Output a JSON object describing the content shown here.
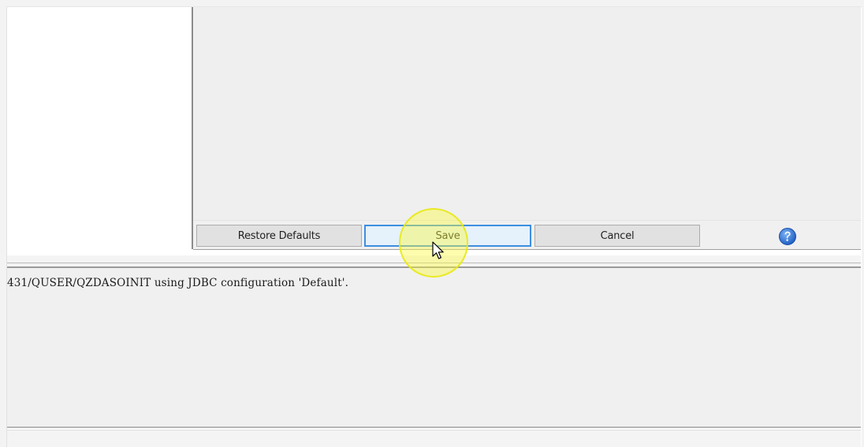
{
  "buttons": {
    "restore_defaults": "Restore Defaults",
    "save": "Save",
    "cancel": "Cancel",
    "help_icon": "help-icon"
  },
  "console": {
    "line": "431/QUSER/QZDASOINIT using JDBC configuration 'Default'."
  },
  "state": {
    "focused_button": "Save",
    "click_highlight": true
  },
  "colors": {
    "highlight": "#fafa3c",
    "focus_border": "#3d8ee0",
    "help_icon": "#2a6fd6"
  }
}
